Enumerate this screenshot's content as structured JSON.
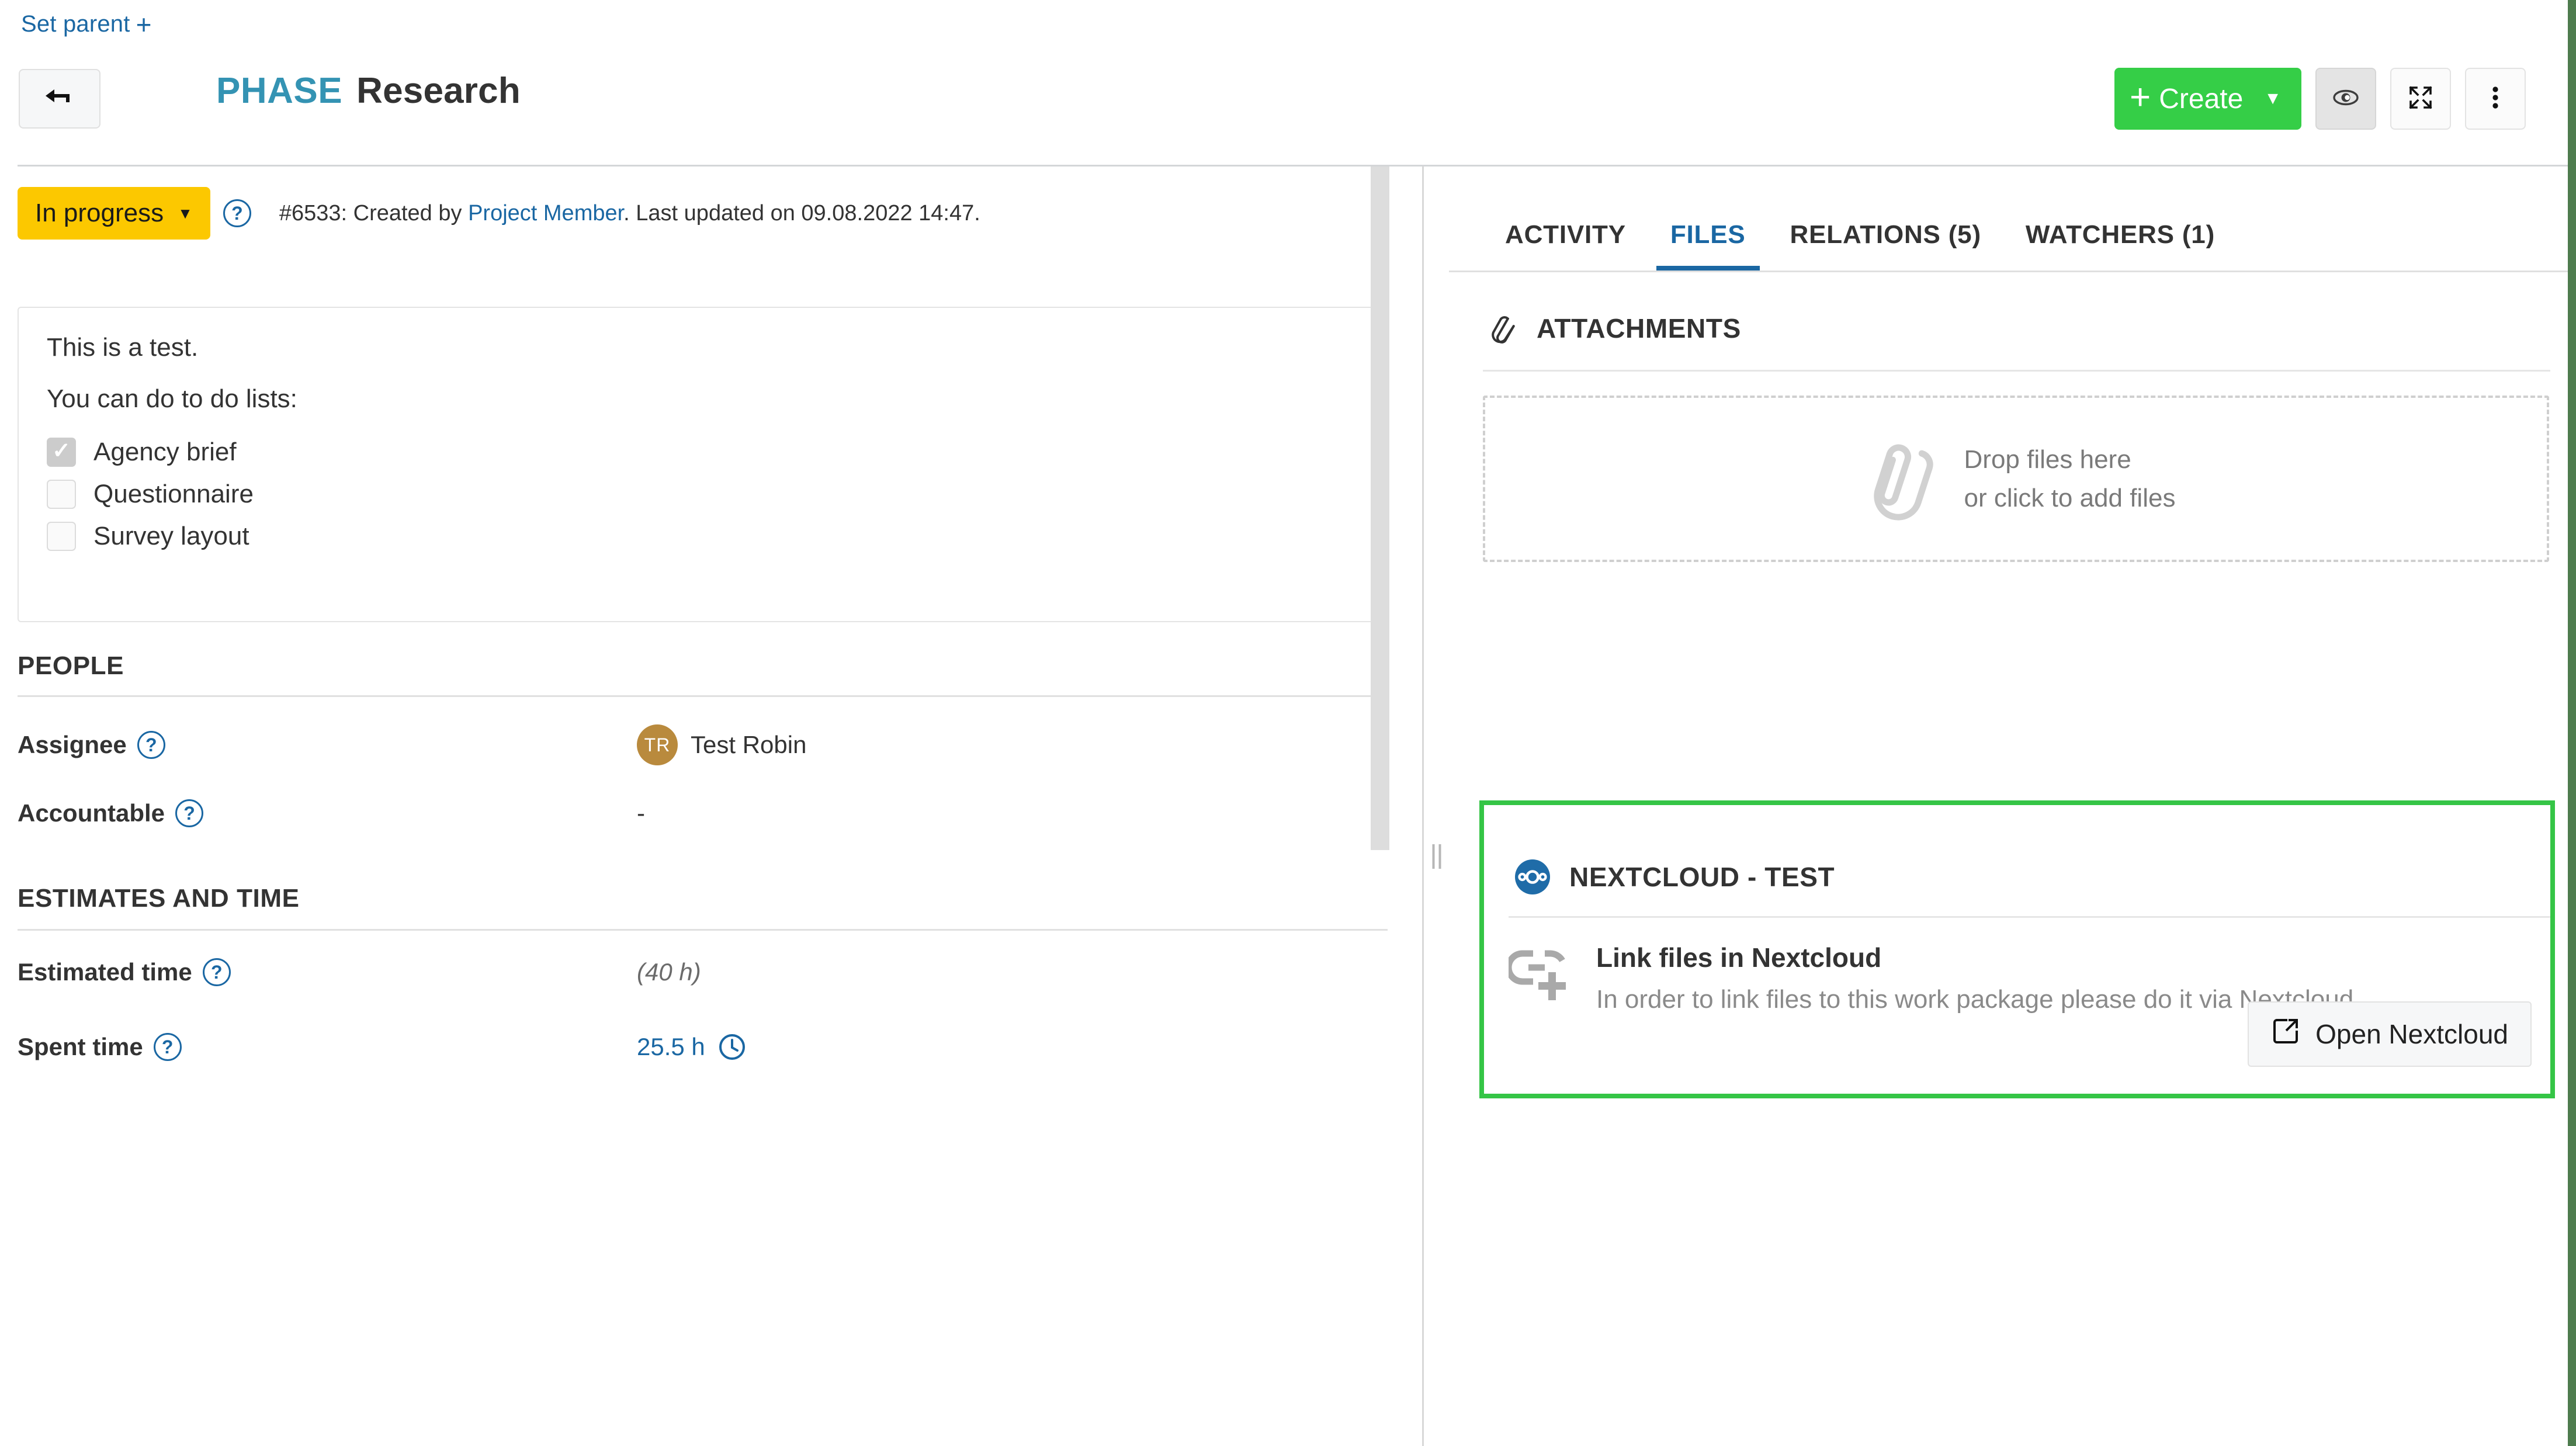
{
  "header": {
    "set_parent_label": "Set parent",
    "set_parent_icon": "plus-icon",
    "back_icon": "arrow-left-icon",
    "type_label": "PHASE",
    "subject": "Research",
    "create_label": "Create",
    "create_plus": "+",
    "create_caret": "▼",
    "watch_icon": "eye-icon",
    "fullscreen_icon": "fullscreen-icon",
    "more_icon": "kebab-menu-icon"
  },
  "status": {
    "value": "In progress",
    "caret": "▼",
    "help_icon": "?",
    "meta_prefix": "#6533: Created by ",
    "meta_author": "Project Member",
    "meta_suffix": ". Last updated on 09.08.2022 14:47."
  },
  "description": {
    "line1": "This is a test.",
    "line2": "You can do to do lists:",
    "todos": [
      {
        "label": "Agency brief",
        "checked": true
      },
      {
        "label": "Questionnaire",
        "checked": false
      },
      {
        "label": "Survey layout",
        "checked": false
      }
    ]
  },
  "people": {
    "heading": "PEOPLE",
    "rows": [
      {
        "label": "Assignee",
        "help": "?",
        "avatar_initials": "TR",
        "value": "Test Robin"
      },
      {
        "label": "Accountable",
        "help": "?",
        "value": "-"
      }
    ]
  },
  "estimates": {
    "heading": "ESTIMATES AND TIME",
    "rows": [
      {
        "label": "Estimated time",
        "help": "?",
        "value": "(40 h)"
      },
      {
        "label": "Spent time",
        "help": "?",
        "value": "25.5 h",
        "icon": "clock-icon"
      }
    ]
  },
  "tabs": [
    {
      "label": "ACTIVITY",
      "active": false
    },
    {
      "label": "FILES",
      "active": true
    },
    {
      "label": "RELATIONS (5)",
      "active": false
    },
    {
      "label": "WATCHERS (1)",
      "active": false
    }
  ],
  "attachments": {
    "icon": "paperclip-icon",
    "heading": "ATTACHMENTS",
    "dropzone_icon": "paperclip-large-icon",
    "dropzone_line1": "Drop files here",
    "dropzone_line2": "or click to add files"
  },
  "nextcloud": {
    "logo": "nextcloud-logo-icon",
    "storage_name": "NEXTCLOUD - TEST",
    "link_icon": "link-add-icon",
    "title": "Link files in Nextcloud",
    "subtitle": "In order to link files to this work package please do it via Nextcloud.",
    "button_label": "Open Nextcloud",
    "button_icon": "external-link-icon"
  },
  "colors": {
    "accent_blue": "#1a67a3",
    "type_blue": "#3493b3",
    "create_green": "#35ce47",
    "highlight_green": "#35c546",
    "status_yellow": "#fcc800",
    "avatar_bronze": "#b98a3d"
  }
}
